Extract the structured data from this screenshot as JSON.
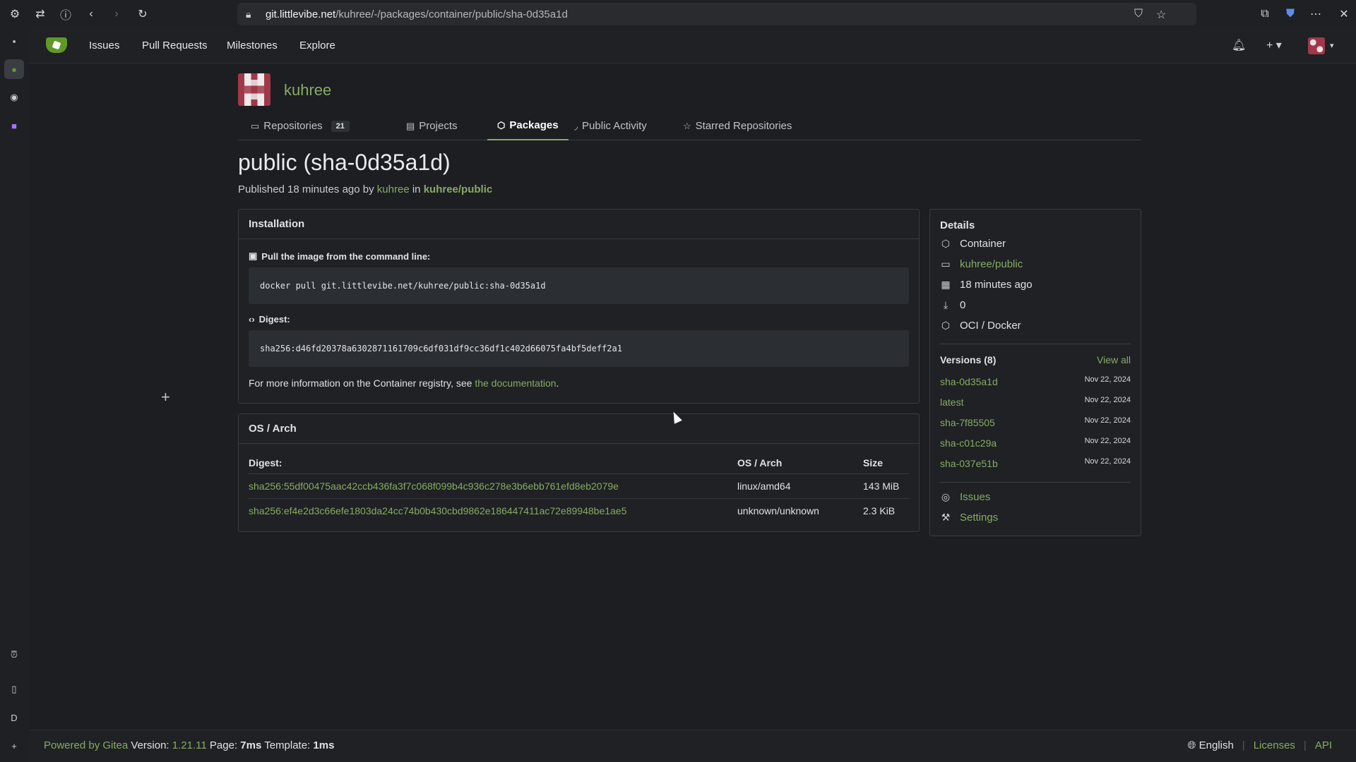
{
  "browser": {
    "url_host": "git.littlevibe.net",
    "url_path": "/kuhree/-/packages/container/public/sha-0d35a1d"
  },
  "nav": {
    "items": [
      "Issues",
      "Pull Requests",
      "Milestones",
      "Explore"
    ]
  },
  "profile": {
    "name": "kuhree",
    "tabs": [
      {
        "label": "Repositories",
        "count": "21"
      },
      {
        "label": "Projects"
      },
      {
        "label": "Packages"
      },
      {
        "label": "Public Activity"
      },
      {
        "label": "Starred Repositories"
      }
    ]
  },
  "package": {
    "title": "public (sha-0d35a1d)",
    "published_prefix": "Published 18 minutes ago by ",
    "author": "kuhree",
    "in_word": " in ",
    "repo": "kuhree/public"
  },
  "installation": {
    "heading": "Installation",
    "pull_label": "Pull the image from the command line:",
    "pull_cmd": "docker pull git.littlevibe.net/kuhree/public:sha-0d35a1d",
    "digest_label": "Digest:",
    "digest_value": "sha256:d46fd20378a6302871161709c6df031df9cc36df1c402d66075fa4bf5deff2a1",
    "more_info_prefix": "For more information on the Container registry, see ",
    "more_info_link": "the documentation",
    "more_info_suffix": "."
  },
  "osarch": {
    "heading": "OS / Arch",
    "columns": [
      "Digest:",
      "OS / Arch",
      "Size"
    ],
    "rows": [
      {
        "digest": "sha256:55df00475aac42ccb436fa3f7c068f099b4c936c278e3b6ebb761efd8eb2079e",
        "osarch": "linux/amd64",
        "size": "143 MiB"
      },
      {
        "digest": "sha256:ef4e2d3c66efe1803da24cc74b0b430cbd9862e186447411ac72e89948be1ae5",
        "osarch": "unknown/unknown",
        "size": "2.3 KiB"
      }
    ]
  },
  "details": {
    "heading": "Details",
    "type": "Container",
    "repo": "kuhree/public",
    "time": "18 minutes ago",
    "downloads": "0",
    "format": "OCI / Docker",
    "versions_heading": "Versions (8)",
    "view_all": "View all",
    "versions": [
      {
        "name": "sha-0d35a1d",
        "date": "Nov 22, 2024"
      },
      {
        "name": "latest",
        "date": "Nov 22, 2024"
      },
      {
        "name": "sha-7f85505",
        "date": "Nov 22, 2024"
      },
      {
        "name": "sha-c01c29a",
        "date": "Nov 22, 2024"
      },
      {
        "name": "sha-037e51b",
        "date": "Nov 22, 2024"
      }
    ],
    "issues": "Issues",
    "settings": "Settings"
  },
  "footer": {
    "powered_by": "Powered by Gitea",
    "version_label": " Version: ",
    "version": "1.21.11",
    "page_label": " Page: ",
    "page_time": "7ms",
    "template_label": " Template: ",
    "template_time": "1ms",
    "language": "English",
    "licenses": "Licenses",
    "api": "API"
  }
}
